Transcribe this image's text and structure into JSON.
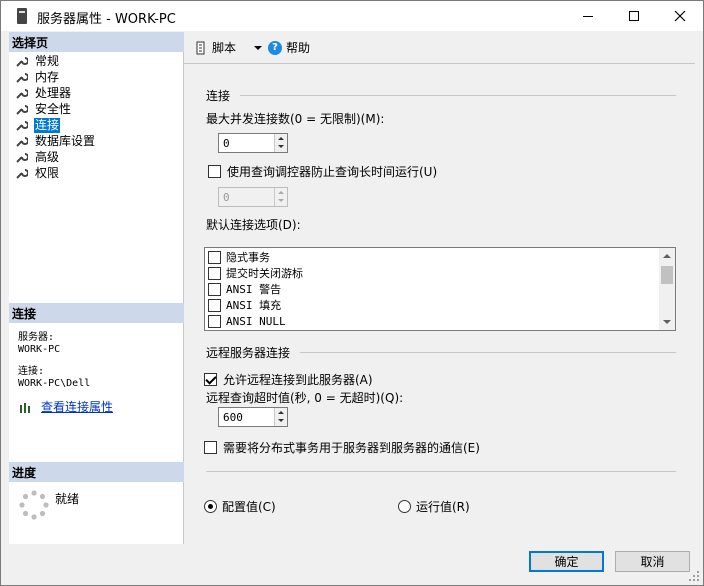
{
  "window": {
    "title": "服务器属性 - WORK-PC"
  },
  "left": {
    "select_page_header": "选择页",
    "pages": [
      {
        "label": "常规"
      },
      {
        "label": "内存"
      },
      {
        "label": "处理器"
      },
      {
        "label": "安全性"
      },
      {
        "label": "连接"
      },
      {
        "label": "数据库设置"
      },
      {
        "label": "高级"
      },
      {
        "label": "权限"
      }
    ],
    "selected_index": 4,
    "connection_header": "连接",
    "server_label": "服务器:",
    "server_value": "WORK-PC",
    "connection_label": "连接:",
    "connection_value": "WORK-PC\\Dell",
    "view_conn_props": "查看连接属性",
    "progress_header": "进度",
    "progress_status": "就绪"
  },
  "toolbar": {
    "script_label": "脚本",
    "help_label": "帮助"
  },
  "connections": {
    "group_title": "连接",
    "max_concurrent_label": "最大并发连接数(0 = 无限制)(M):",
    "max_concurrent_value": "0",
    "use_governor_label": "使用查询调控器防止查询长时间运行(U)",
    "use_governor_checked": false,
    "governor_value": "0",
    "default_options_label": "默认连接选项(D):",
    "options": [
      {
        "label": "隐式事务",
        "checked": false
      },
      {
        "label": "提交时关闭游标",
        "checked": false
      },
      {
        "label": "ANSI 警告",
        "checked": false
      },
      {
        "label": "ANSI 填充",
        "checked": false
      },
      {
        "label": "ANSI NULL",
        "checked": false
      }
    ]
  },
  "remote": {
    "group_title": "远程服务器连接",
    "allow_remote_label": "允许远程连接到此服务器(A)",
    "allow_remote_checked": true,
    "timeout_label": "远程查询超时值(秒, 0 = 无超时)(Q):",
    "timeout_value": "600",
    "distributed_label": "需要将分布式事务用于服务器到服务器的通信(E)",
    "distributed_checked": false
  },
  "values_mode": {
    "configured_label": "配置值(C)",
    "running_label": "运行值(R)",
    "selected": "configured"
  },
  "footer": {
    "ok_label": "确定",
    "cancel_label": "取消"
  },
  "colors": {
    "accent": "#0078d7",
    "section_header": "#cdd9ea",
    "link": "#0033cc"
  }
}
